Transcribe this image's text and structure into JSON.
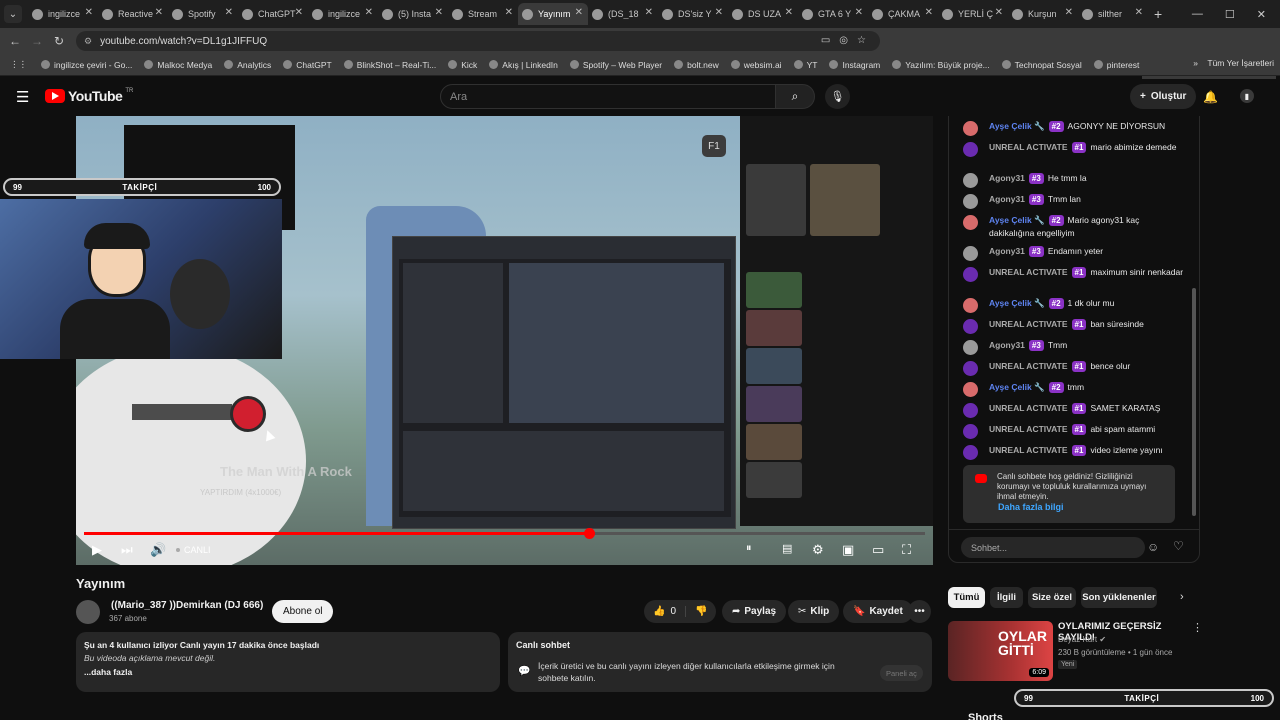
{
  "browser": {
    "tabs": [
      {
        "label": "ingilizce",
        "active": false
      },
      {
        "label": "Reactive",
        "active": false
      },
      {
        "label": "Spotify",
        "active": false
      },
      {
        "label": "ChatGPT",
        "active": false
      },
      {
        "label": "ingilizce",
        "active": false
      },
      {
        "label": "(5) Insta",
        "active": false
      },
      {
        "label": "Stream",
        "active": false
      },
      {
        "label": "Yayınım",
        "active": true
      },
      {
        "label": "(DS_18",
        "active": false
      },
      {
        "label": "DS'siz Y",
        "active": false
      },
      {
        "label": "DS UZA",
        "active": false
      },
      {
        "label": "GTA 6 Y",
        "active": false
      },
      {
        "label": "ÇAKMA",
        "active": false
      },
      {
        "label": "YERLİ Ç",
        "active": false
      },
      {
        "label": "Kurşun",
        "active": false
      },
      {
        "label": "silther",
        "active": false
      }
    ],
    "new_tab": "+",
    "window_controls": {
      "minimize": "—",
      "maximize": "☐",
      "close": "✕"
    },
    "url": "youtube.com/watch?v=DL1g1JIFFUQ",
    "update_label": "Güncellemek için yeniden başlat",
    "bookmarks": [
      "ingilizce çeviri - Go...",
      "Malkoc Medya",
      "Analytics",
      "ChatGPT",
      "BlinkShot – Real-Ti...",
      "Kick",
      "Akış | LinkedIn",
      "Spotify – Web Player",
      "bolt.new",
      "websim.ai",
      "YT",
      "Instagram",
      "Yazılım: Büyük proje...",
      "Technopat Sosyal",
      "pinterest"
    ],
    "bookmarks_more": "»",
    "all_bookmarks": "Tüm Yer İşaretleri"
  },
  "youtube": {
    "logo_text": "YouTube",
    "logo_country": "TR",
    "search_placeholder": "Ara",
    "create_label": "Oluştur",
    "accent": "#ff0000"
  },
  "player": {
    "webcam_follow_left": "99",
    "webcam_follow_label": "TAKİPÇİ",
    "webcam_follow_right": "100",
    "f1_badge": "F1",
    "scene_caption": "The Man With A Rock",
    "scene_sub": "YAPTIRDIM (4x1000€)",
    "live_label": "CANLI",
    "progress": 0.6
  },
  "video": {
    "title": "Yayınım",
    "channel_name": "((Mario_387 ))Demirkan (DJ 666)",
    "subscribers": "367 abone",
    "subscribe_label": "Abone ol",
    "likes": "0",
    "share_label": "Paylaş",
    "clip_label": "Klip",
    "save_label": "Kaydet",
    "description_line1": "Şu an 4 kullanıcı izliyor  Canlı yayın 17 dakika önce başladı",
    "description_line2": "Bu videoda açıklama mevcut değil.",
    "description_more": "...daha fazla"
  },
  "live_chat_card": {
    "title": "Canlı sohbet",
    "body": "İçerik üretici ve bu canlı yayını izleyen diğer kullanıcılarla etkileşime girmek için sohbete katılın.",
    "panel_button": "Paneli aç"
  },
  "chat": {
    "messages": [
      {
        "author": "Ayşe Çelik 🔧",
        "mod": true,
        "rank": "#2",
        "text": "AGONYY NE DİYORSUN",
        "avatar": "#d86b6b"
      },
      {
        "author": "UNREAL ACTIVATE",
        "mod": false,
        "rank": "#1",
        "text": "mario abimize demede",
        "avatar": "#6a2bb0"
      },
      {
        "author": "Agony31",
        "mod": false,
        "rank": "#3",
        "text": "He tmm la",
        "avatar": "#9a9a9a"
      },
      {
        "author": "Agony31",
        "mod": false,
        "rank": "#3",
        "text": "Tmm lan",
        "avatar": "#9a9a9a"
      },
      {
        "author": "Ayşe Çelik 🔧",
        "mod": true,
        "rank": "#2",
        "text": "Mario agony31 kaç dakikalığına engelliyim",
        "avatar": "#d86b6b"
      },
      {
        "author": "Agony31",
        "mod": false,
        "rank": "#3",
        "text": "Endamın yeter",
        "avatar": "#9a9a9a"
      },
      {
        "author": "UNREAL ACTIVATE",
        "mod": false,
        "rank": "#1",
        "text": "maximum sinir nenkadar",
        "avatar": "#6a2bb0"
      },
      {
        "author": "Ayşe Çelik 🔧",
        "mod": true,
        "rank": "#2",
        "text": "1 dk olur mu",
        "avatar": "#d86b6b"
      },
      {
        "author": "UNREAL ACTIVATE",
        "mod": false,
        "rank": "#1",
        "text": "ban süresinde",
        "avatar": "#6a2bb0"
      },
      {
        "author": "Agony31",
        "mod": false,
        "rank": "#3",
        "text": "Tmm",
        "avatar": "#9a9a9a"
      },
      {
        "author": "UNREAL ACTIVATE",
        "mod": false,
        "rank": "#1",
        "text": "bence olur",
        "avatar": "#6a2bb0"
      },
      {
        "author": "Ayşe Çelik 🔧",
        "mod": true,
        "rank": "#2",
        "text": "tmm",
        "avatar": "#d86b6b"
      },
      {
        "author": "UNREAL ACTIVATE",
        "mod": false,
        "rank": "#1",
        "text": "SAMET KARATAŞ",
        "avatar": "#6a2bb0"
      },
      {
        "author": "UNREAL ACTIVATE",
        "mod": false,
        "rank": "#1",
        "text": "abi spam atammi",
        "avatar": "#6a2bb0"
      },
      {
        "author": "UNREAL ACTIVATE",
        "mod": false,
        "rank": "#1",
        "text": "video izleme yayını",
        "avatar": "#6a2bb0"
      }
    ],
    "welcome_text": "Canlı sohbete hoş geldiniz! Gizliliğinizi korumayı ve topluluk kurallarımıza uymayı ihmal etmeyin.",
    "learn_more": "Daha fazla bilgi",
    "input_placeholder": "Sohbet..."
  },
  "related": {
    "chips": [
      "Tümü",
      "İlgili",
      "Size özel",
      "Son yüklenenler"
    ],
    "item": {
      "thumb_text": "OYLAR GİTTİ",
      "duration": "6:09",
      "title": "OYLARIMIZ GEÇERSİZ SAYILDI",
      "channel": "Beyaz Kurt",
      "meta": "230 B görüntüleme • 1 gün önce",
      "badge": "Yeni"
    },
    "follow_left": "99",
    "follow_label": "TAKİPÇİ",
    "follow_right": "100",
    "shorts_heading": "Shorts"
  }
}
